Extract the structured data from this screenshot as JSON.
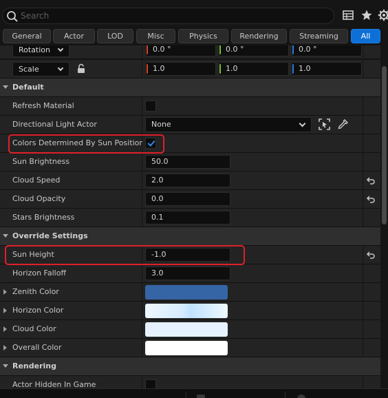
{
  "search": {
    "placeholder": "Search"
  },
  "toolbar": {
    "icons": [
      "table-view-icon",
      "favorite-star-icon",
      "settings-gear-icon"
    ]
  },
  "filters": [
    "General",
    "Actor",
    "LOD",
    "Misc",
    "Physics",
    "Rendering",
    "Streaming",
    "All"
  ],
  "active_filter": "All",
  "transform": {
    "rotation_label": "Rotation",
    "rotation_values": [
      "0.0 °",
      "0.0 °",
      "0.0 °"
    ],
    "scale_label": "Scale",
    "scale_values": [
      "1.0",
      "1.0",
      "1.0"
    ]
  },
  "sections": {
    "default": "Default",
    "override": "Override Settings",
    "rendering": "Rendering"
  },
  "default_props": {
    "refresh_material": {
      "label": "Refresh Material",
      "checked": false
    },
    "directional_light": {
      "label": "Directional Light Actor",
      "value": "None"
    },
    "colors_by_sun": {
      "label": "Colors Determined By Sun Position",
      "checked": true
    },
    "sun_brightness": {
      "label": "Sun Brightness",
      "value": "50.0"
    },
    "cloud_speed": {
      "label": "Cloud Speed",
      "value": "2.0"
    },
    "cloud_opacity": {
      "label": "Cloud Opacity",
      "value": "0.0"
    },
    "stars_brightness": {
      "label": "Stars Brightness",
      "value": "0.1"
    }
  },
  "override_props": {
    "sun_height": {
      "label": "Sun Height",
      "value": "-1.0"
    },
    "horizon_falloff": {
      "label": "Horizon Falloff",
      "value": "3.0"
    },
    "zenith_color": {
      "label": "Zenith Color",
      "color": "#3665a6"
    },
    "horizon_color": {
      "label": "Horizon Color",
      "color": "#e8f4ff"
    },
    "cloud_color": {
      "label": "Cloud Color",
      "color": "#e6f2ff"
    },
    "overall_color": {
      "label": "Overall Color",
      "color": "#ffffff"
    }
  },
  "rendering_props": {
    "actor_hidden": {
      "label": "Actor Hidden In Game",
      "checked": false
    }
  },
  "colors": {
    "accent": "#0e70d6",
    "highlight": "#e0202a",
    "axis_x": "#d8442c",
    "axis_y": "#78c02a",
    "axis_z": "#2c78e0"
  }
}
